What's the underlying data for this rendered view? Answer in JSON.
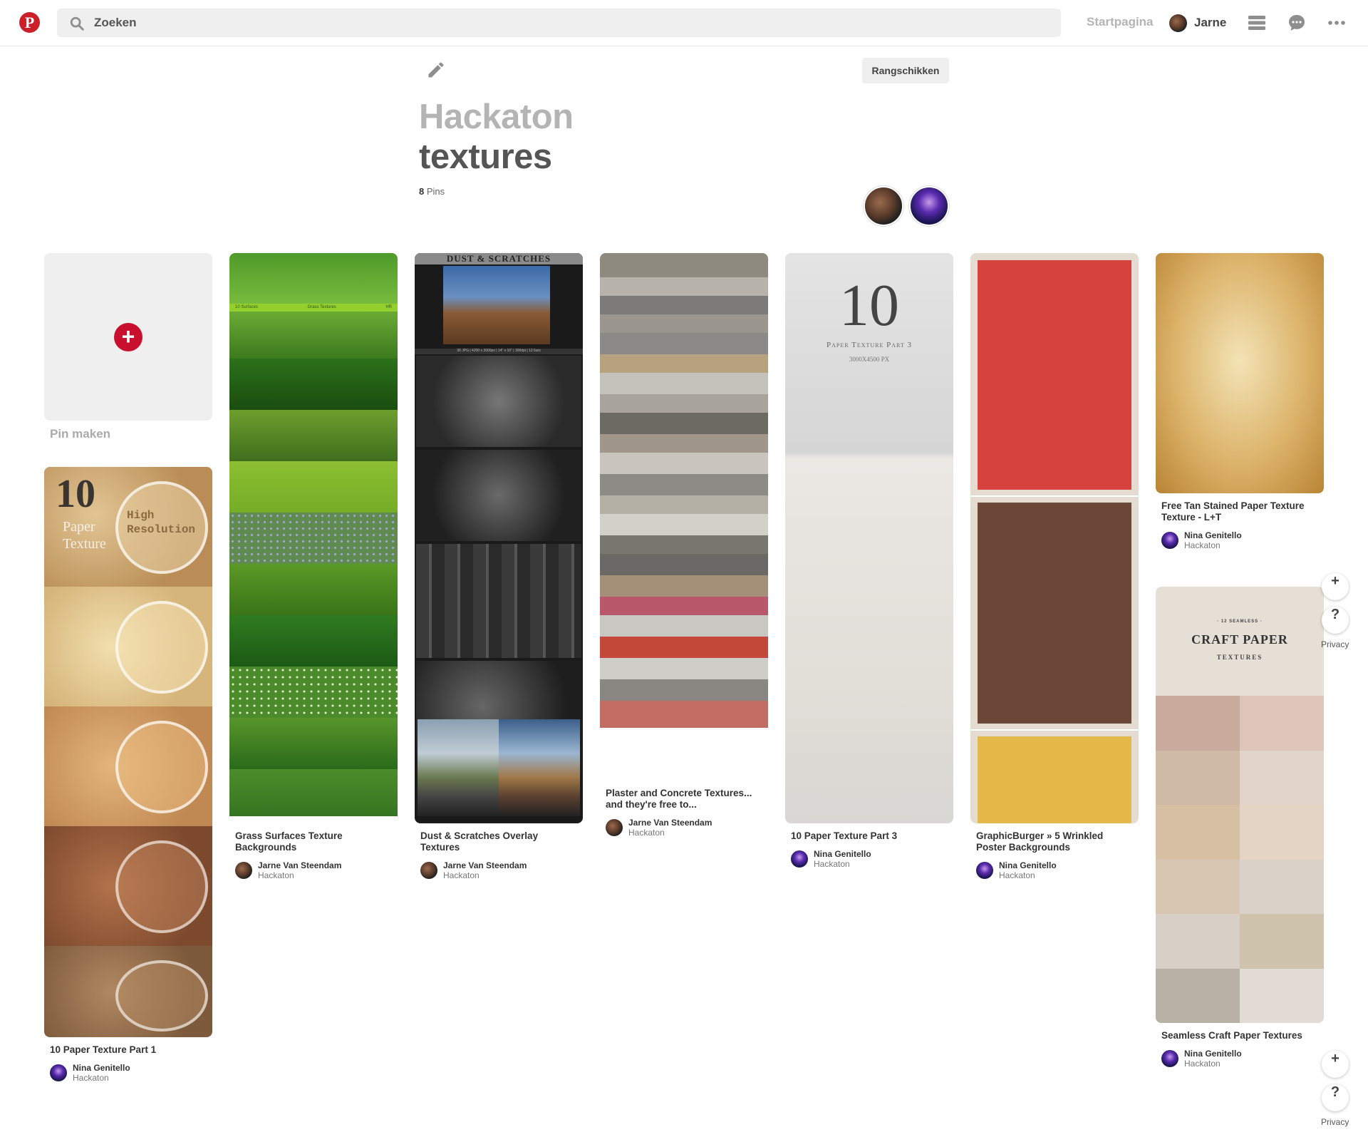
{
  "header": {
    "logo_glyph": "P",
    "search_placeholder": "Zoeken",
    "home_label": "Startpagina",
    "user_name": "Jarne"
  },
  "board": {
    "title_line1": "Hackaton",
    "title_line2": "textures",
    "pin_count": "8",
    "pin_count_label": "Pins",
    "arrange_label": "Rangschikken"
  },
  "create_pin": {
    "label": "Pin maken",
    "plus": "+"
  },
  "pins": [
    {
      "title": "10 Paper Texture Part 1",
      "user": "Nina Genitello",
      "board": "Hackaton"
    },
    {
      "title": "Grass Surfaces Texture Backgrounds",
      "user": "Jarne Van Steendam",
      "board": "Hackaton"
    },
    {
      "title": "Dust & Scratches Overlay Textures",
      "user": "Jarne Van Steendam",
      "board": "Hackaton"
    },
    {
      "title": "Plaster and Concrete Textures... and they're free to...",
      "user": "Jarne Van Steendam",
      "board": "Hackaton"
    },
    {
      "title": "10 Paper Texture Part 3",
      "user": "Nina Genitello",
      "board": "Hackaton"
    },
    {
      "title": "GraphicBurger » 5 Wrinkled Poster Backgrounds",
      "user": "Nina Genitello",
      "board": "Hackaton"
    },
    {
      "title": "Free Tan Stained Paper Texture Texture - L+T",
      "user": "Nina Genitello",
      "board": "Hackaton"
    },
    {
      "title": "Seamless Craft Paper Textures",
      "user": "Nina Genitello",
      "board": "Hackaton"
    }
  ],
  "image_text": {
    "paper1_big": "10",
    "paper1_small1": "Paper",
    "paper1_small2": "Texture",
    "paper1_badge1": "High",
    "paper1_badge2": "Resolution",
    "grass_band_left": "10 Surfaces",
    "grass_band_mid": "Grass Textures",
    "grass_band_right": "HR",
    "dust_title": "DUST & SCRATCHES",
    "dust_spec": "30 JPG | 4200 x 3000px | 14\" x 10\" | 300dpi | 12.5urs",
    "paper3_big": "10",
    "paper3_sub": "Paper Texture Part 3",
    "paper3_size": "3000X4500 PX",
    "craft_top": "· 12 SEAMLESS ·",
    "craft_title": "CRAFT PAPER",
    "craft_sub": "TEXTURES"
  },
  "side": {
    "plus": "+",
    "help": "?",
    "privacy": "Privacy"
  },
  "colors": {
    "pinterest_red": "#cb2027",
    "create_red": "#c8102e"
  }
}
